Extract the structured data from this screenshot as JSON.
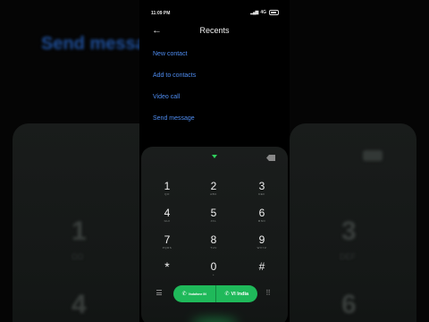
{
  "status": {
    "time": "11:09 PM",
    "network": "4G"
  },
  "header": {
    "title": "Recents"
  },
  "menu": [
    {
      "label": "New contact"
    },
    {
      "label": "Add to contacts"
    },
    {
      "label": "Video call"
    },
    {
      "label": "Send message"
    }
  ],
  "keys": [
    {
      "digit": "1",
      "sub": "QO"
    },
    {
      "digit": "2",
      "sub": "ABC"
    },
    {
      "digit": "3",
      "sub": "DEF"
    },
    {
      "digit": "4",
      "sub": "GHI"
    },
    {
      "digit": "5",
      "sub": "JKL"
    },
    {
      "digit": "6",
      "sub": "MNO"
    },
    {
      "digit": "7",
      "sub": "PQRS"
    },
    {
      "digit": "8",
      "sub": "TUV"
    },
    {
      "digit": "9",
      "sub": "WXYZ"
    },
    {
      "digit": "*",
      "sub": ""
    },
    {
      "digit": "0",
      "sub": "+"
    },
    {
      "digit": "#",
      "sub": ""
    }
  ],
  "call": {
    "sim1_label": "Vodafone IN",
    "sim2_label": "VI India"
  },
  "background": {
    "title": "Send messa",
    "digits": [
      "1",
      "4",
      "3",
      "6"
    ]
  },
  "colors": {
    "accent_green": "#1fb95a",
    "link_blue": "#4e8cf0",
    "pad_bg": "#1a1d1c"
  }
}
